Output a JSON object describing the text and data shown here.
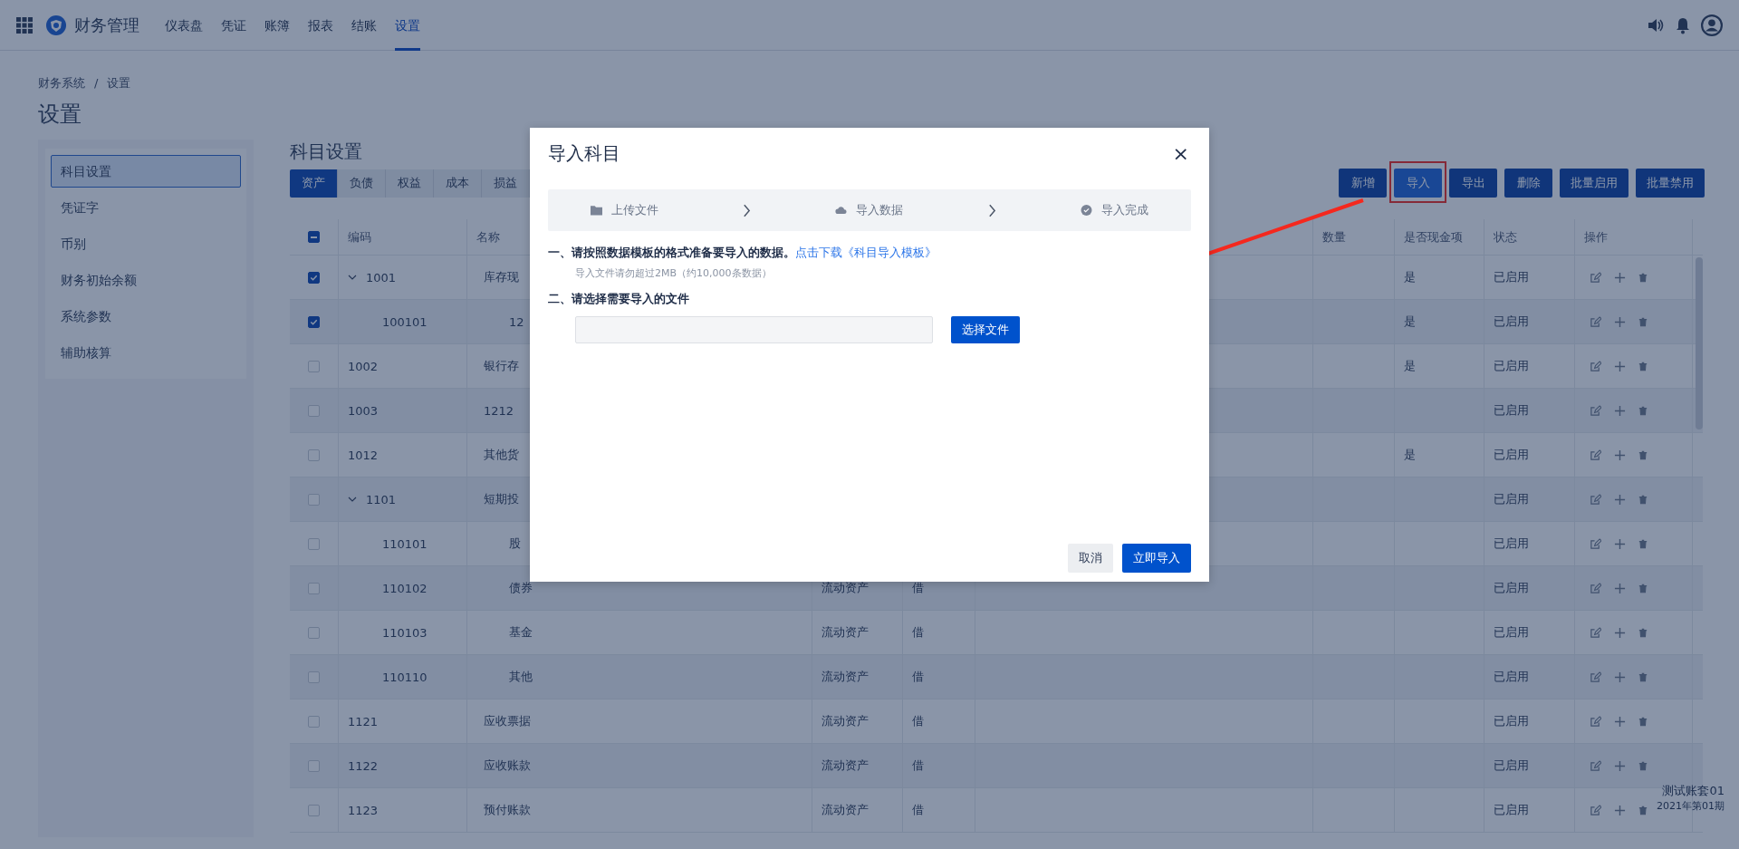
{
  "nav": {
    "app_name": "财务管理",
    "items": [
      {
        "label": "仪表盘",
        "selected": false
      },
      {
        "label": "凭证",
        "selected": false
      },
      {
        "label": "账簿",
        "selected": false
      },
      {
        "label": "报表",
        "selected": false
      },
      {
        "label": "结账",
        "selected": false
      },
      {
        "label": "设置",
        "selected": true
      }
    ]
  },
  "breadcrumb": {
    "items": [
      "财务系统",
      "设置"
    ],
    "separator": "/"
  },
  "page_title": "设置",
  "sidebar": {
    "items": [
      {
        "label": "科目设置",
        "selected": true
      },
      {
        "label": "凭证字",
        "selected": false
      },
      {
        "label": "币别",
        "selected": false
      },
      {
        "label": "财务初始余额",
        "selected": false
      },
      {
        "label": "系统参数",
        "selected": false
      },
      {
        "label": "辅助核算",
        "selected": false
      }
    ]
  },
  "section_title": "科目设置",
  "category_tabs": [
    {
      "label": "资产",
      "selected": true
    },
    {
      "label": "负债",
      "selected": false
    },
    {
      "label": "权益",
      "selected": false
    },
    {
      "label": "成本",
      "selected": false
    },
    {
      "label": "损益",
      "selected": false
    }
  ],
  "toolbar_buttons": [
    {
      "label": "新增",
      "hovered": false,
      "boxed": false
    },
    {
      "label": "导入",
      "hovered": true,
      "boxed": true
    },
    {
      "label": "导出",
      "hovered": false,
      "boxed": false
    },
    {
      "label": "删除",
      "hovered": false,
      "boxed": false
    },
    {
      "label": "批量启用",
      "hovered": false,
      "boxed": false
    },
    {
      "label": "批量禁用",
      "hovered": false,
      "boxed": false
    }
  ],
  "arrow_annotation": true,
  "table": {
    "select_all_partial": true,
    "columns": {
      "code": "编码",
      "name": "名称",
      "quantity": "数量",
      "cash": "是否现金项",
      "status": "状态",
      "actions": "操作"
    },
    "rows": [
      {
        "code": "1001",
        "name": "库存现",
        "cash": "是",
        "status": "已启用",
        "checked": true,
        "expanded": true,
        "children": [
          {
            "code": "100101",
            "name": "12",
            "cash": "是",
            "status": "已启用",
            "checked": true
          }
        ]
      },
      {
        "code": "1002",
        "name": "银行存",
        "cash": "是",
        "status": "已启用",
        "checked": false
      },
      {
        "code": "1003",
        "name": "1212",
        "status": "已启用",
        "checked": false
      },
      {
        "code": "1012",
        "name": "其他货",
        "cash": "是",
        "status": "已启用",
        "checked": false
      },
      {
        "code": "1101",
        "name": "短期投",
        "status": "已启用",
        "checked": false,
        "expanded": true,
        "children": [
          {
            "code": "110101",
            "name": "股",
            "status": "已启用",
            "checked": false
          },
          {
            "code": "110102",
            "name": "债券",
            "category": "流动资产",
            "direction": "借",
            "status": "已启用",
            "checked": false
          },
          {
            "code": "110103",
            "name": "基金",
            "category": "流动资产",
            "direction": "借",
            "status": "已启用",
            "checked": false
          },
          {
            "code": "110110",
            "name": "其他",
            "category": "流动资产",
            "direction": "借",
            "status": "已启用",
            "checked": false
          }
        ]
      },
      {
        "code": "1121",
        "name": "应收票据",
        "category": "流动资产",
        "direction": "借",
        "status": "已启用",
        "checked": false
      },
      {
        "code": "1122",
        "name": "应收账款",
        "category": "流动资产",
        "direction": "借",
        "status": "已启用",
        "checked": false
      },
      {
        "code": "1123",
        "name": "预付账款",
        "category": "流动资产",
        "direction": "借",
        "status": "已启用",
        "checked": false
      }
    ]
  },
  "account": {
    "name": "测试账套01",
    "period": "2021年第01期"
  },
  "modal": {
    "title": "导入科目",
    "close": "×",
    "steps": [
      {
        "label": "上传文件",
        "kind": "upload"
      },
      {
        "label": "导入数据",
        "kind": "import"
      },
      {
        "label": "导入完成",
        "kind": "done"
      }
    ],
    "step1": "一、请按照数据模板的格式准备要导入的数据。",
    "template_link": "点击下载《科目导入模板》",
    "hint": "导入文件请勿超过2MB（约10,000条数据）",
    "step2": "二、请选择需要导入的文件",
    "choose_button": "选择文件",
    "cancel_button": "取消",
    "confirm_button": "立即导入"
  }
}
